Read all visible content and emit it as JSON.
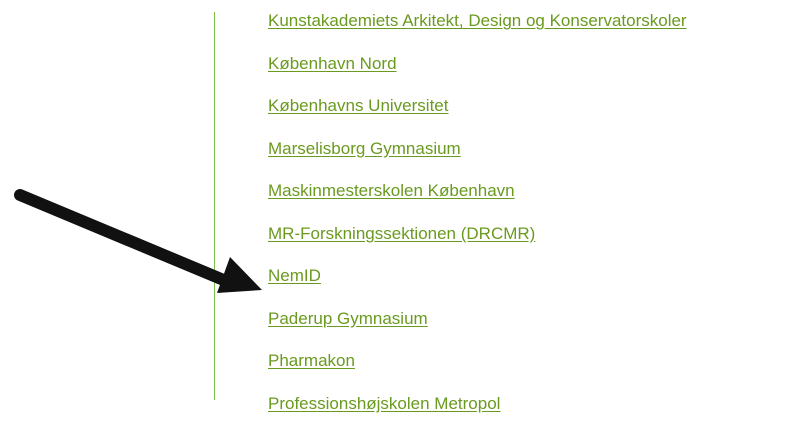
{
  "links": [
    {
      "label": "Kunstakademiets Arkitekt, Design og Konservatorskoler"
    },
    {
      "label": "København Nord"
    },
    {
      "label": "Københavns Universitet"
    },
    {
      "label": "Marselisborg Gymnasium"
    },
    {
      "label": "Maskinmesterskolen København"
    },
    {
      "label": "MR-Forskningssektionen (DRCMR)"
    },
    {
      "label": "NemID"
    },
    {
      "label": "Paderup Gymnasium"
    },
    {
      "label": "Pharmakon"
    },
    {
      "label": "Professionshøjskolen Metropol"
    }
  ],
  "colors": {
    "link": "#6a9a1f",
    "divider": "#7cc04b",
    "arrow": "#111111"
  }
}
